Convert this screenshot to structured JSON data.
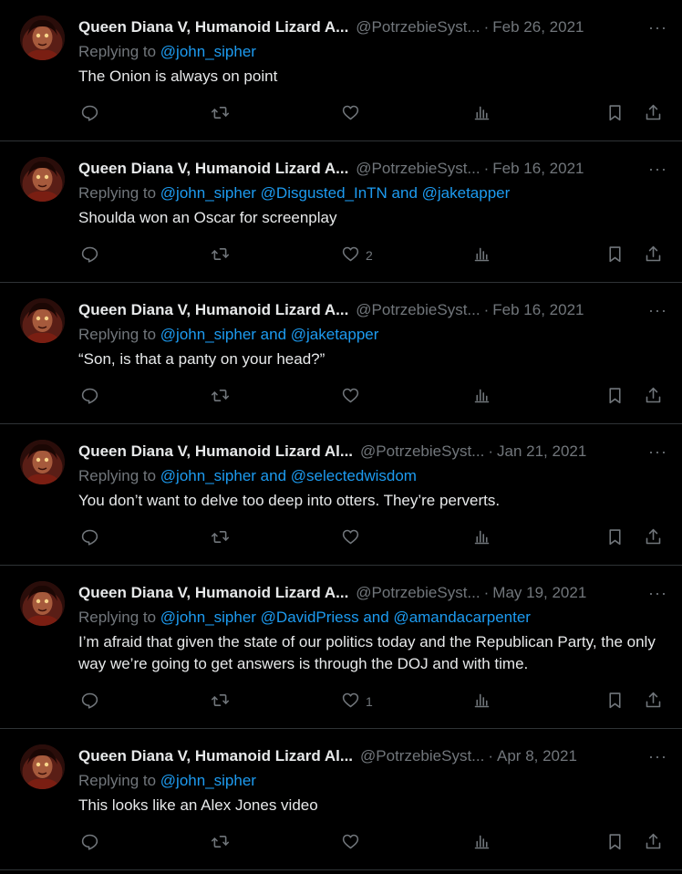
{
  "tweets": [
    {
      "name": "Queen Diana V, Humanoid Lizard A...",
      "handle": "@PotrzebieSyst...",
      "date": "Feb 26, 2021",
      "replying_prefix": "Replying to",
      "mentions": "@john_sipher",
      "text": "The Onion is always on point",
      "likes": ""
    },
    {
      "name": "Queen Diana V, Humanoid Lizard A...",
      "handle": "@PotrzebieSyst...",
      "date": "Feb 16, 2021",
      "replying_prefix": "Replying to",
      "mentions": "@john_sipher @Disgusted_InTN and @jaketapper",
      "text": "Shoulda won an Oscar for screenplay",
      "likes": "2"
    },
    {
      "name": "Queen Diana V, Humanoid Lizard A...",
      "handle": "@PotrzebieSyst...",
      "date": "Feb 16, 2021",
      "replying_prefix": "Replying to",
      "mentions": "@john_sipher and @jaketapper",
      "text": "“Son, is that a panty on your head?”",
      "likes": ""
    },
    {
      "name": "Queen Diana V, Humanoid Lizard Al...",
      "handle": "@PotrzebieSyst...",
      "date": "Jan 21, 2021",
      "replying_prefix": "Replying to",
      "mentions": "@john_sipher and @selectedwisdom",
      "text": "You don’t want to delve too deep into otters. They’re perverts.",
      "likes": ""
    },
    {
      "name": "Queen Diana V, Humanoid Lizard A...",
      "handle": "@PotrzebieSyst...",
      "date": "May 19, 2021",
      "replying_prefix": "Replying to",
      "mentions": "@john_sipher @DavidPriess and @amandacarpenter",
      "text": "I’m afraid that given the state of our politics today and the Republican Party, the only way we’re going to get answers is through the DOJ and with time.",
      "likes": "1"
    },
    {
      "name": "Queen Diana V, Humanoid Lizard Al...",
      "handle": "@PotrzebieSyst...",
      "date": "Apr 8, 2021",
      "replying_prefix": "Replying to",
      "mentions": "@john_sipher",
      "text": "This looks like an Alex Jones video",
      "likes": ""
    }
  ],
  "separator": "·",
  "more_glyph": "···",
  "icons": {
    "reply": "reply-icon",
    "retweet": "retweet-icon",
    "like": "heart-icon",
    "views": "views-icon",
    "bookmark": "bookmark-icon",
    "share": "share-icon"
  },
  "colors": {
    "background": "#000000",
    "text": "#e7e9ea",
    "muted": "#71767b",
    "link": "#1d9bf0",
    "divider": "#2f3336"
  }
}
